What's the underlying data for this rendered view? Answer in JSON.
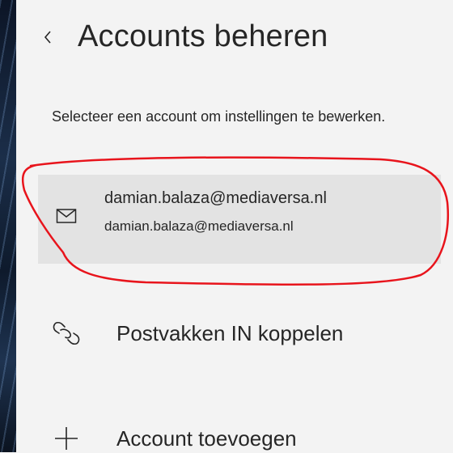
{
  "header": {
    "back_label": "‹",
    "title": "Accounts beheren"
  },
  "main": {
    "description": "Selecteer een account om instellingen te bewerken.",
    "accounts": [
      {
        "icon": "mail-icon",
        "display_name": "damian.balaza@mediaversa.nl",
        "email": "damian.balaza@mediaversa.nl",
        "highlighted": true
      }
    ],
    "actions": [
      {
        "icon": "link-inboxes-icon",
        "label": "Postvakken IN koppelen"
      },
      {
        "icon": "plus-icon",
        "label": "Account toevoegen"
      }
    ]
  },
  "colors": {
    "background": "#f3f3f3",
    "selected_row": "#e3e3e3",
    "annotation": "#e8141c",
    "text": "#262626"
  }
}
